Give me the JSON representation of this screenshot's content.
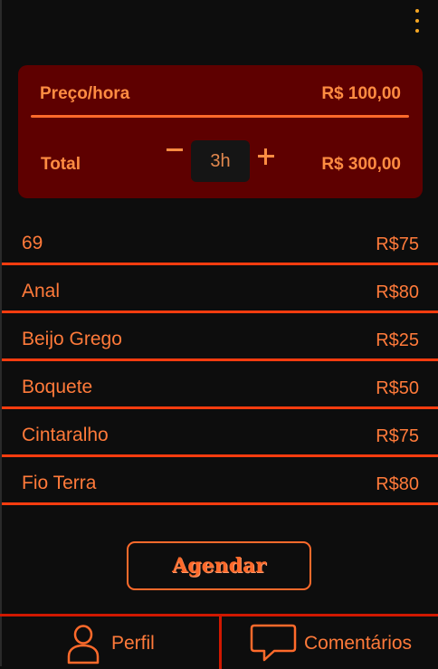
{
  "menu": {
    "icon": "kebab-menu-icon"
  },
  "pricing": {
    "price_per_hour_label": "Preço/hora",
    "price_per_hour_value": "R$ 100,00",
    "total_label": "Total",
    "hours_value": "3h",
    "total_value": "R$ 300,00",
    "decrement_icon": "minus-icon",
    "increment_icon": "plus-icon"
  },
  "services": [
    {
      "name": "69",
      "price": "R$75"
    },
    {
      "name": "Anal",
      "price": "R$80"
    },
    {
      "name": "Beijo Grego",
      "price": "R$25"
    },
    {
      "name": "Boquete",
      "price": "R$50"
    },
    {
      "name": "Cintaralho",
      "price": "R$75"
    },
    {
      "name": "Fio Terra",
      "price": "R$80"
    }
  ],
  "actions": {
    "schedule_label": "Agendar"
  },
  "nav": {
    "profile_label": "Perfil",
    "profile_icon": "user-icon",
    "comments_label": "Comentários",
    "comments_icon": "chat-bubble-icon"
  },
  "colors": {
    "background": "#0d0d0d",
    "card": "#5e0000",
    "accent": "#ff6a2b",
    "text": "#ff7a3a",
    "divider": "#ff3c0f",
    "nav_border": "#d01800",
    "menu_dots": "#f5a623"
  }
}
